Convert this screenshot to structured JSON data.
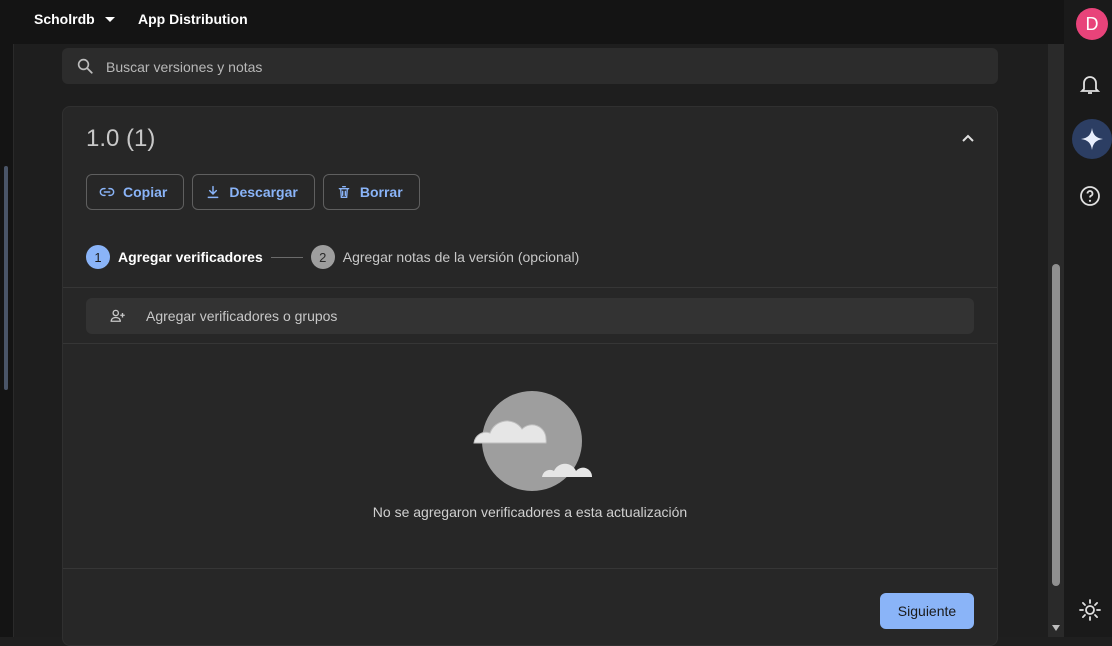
{
  "header": {
    "project_name": "Scholrdb",
    "product_name": "App Distribution"
  },
  "search": {
    "placeholder": "Buscar versiones y notas"
  },
  "release": {
    "version_title": "1.0 (1)",
    "actions": {
      "copy_label": "Copiar",
      "download_label": "Descargar",
      "delete_label": "Borrar"
    },
    "steps": [
      {
        "number": "1",
        "label": "Agregar verificadores"
      },
      {
        "number": "2",
        "label": "Agregar notas de la versión (opcional)"
      }
    ],
    "add_testers_label": "Agregar verificadores o grupos",
    "empty_message": "No se agregaron verificadores a esta actualización",
    "next_label": "Siguiente"
  },
  "user": {
    "avatar_initial": "D",
    "avatar_color": "#e8437a"
  },
  "colors": {
    "accent": "#8ab4f8"
  },
  "icons": [
    "search-icon",
    "chevron-up-icon",
    "link-icon",
    "download-icon",
    "trash-icon",
    "add-person-icon",
    "bell-icon",
    "gemini-sparkle-icon",
    "help-icon",
    "brightness-icon"
  ]
}
